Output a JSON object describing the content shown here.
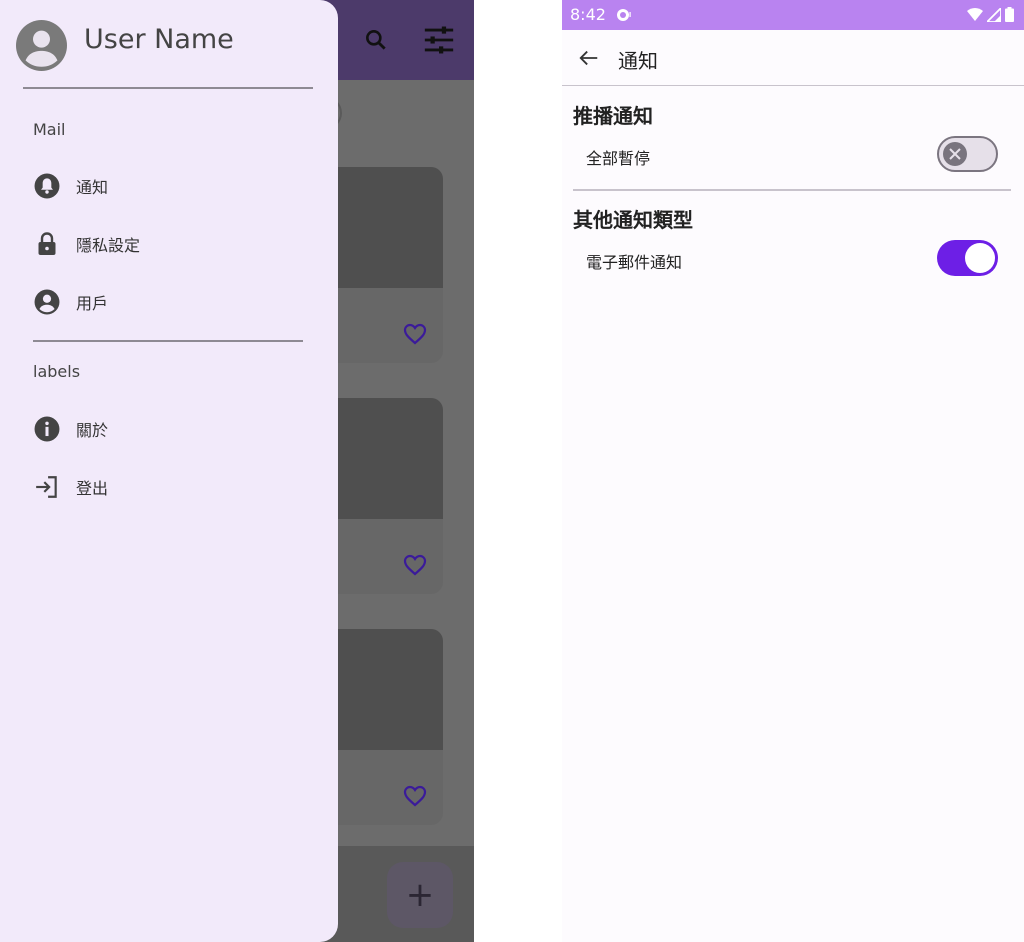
{
  "left_phone": {
    "appbar": {
      "search_icon": "search-icon",
      "filter_icon": "tune-icon"
    },
    "fab_label": "+",
    "drawer": {
      "user_name": "User Name",
      "sections": [
        {
          "label": "Mail"
        },
        {
          "label": "labels"
        }
      ],
      "items": [
        {
          "label": "通知",
          "icon": "bell-icon"
        },
        {
          "label": "隱私設定",
          "icon": "lock-icon"
        },
        {
          "label": "用戶",
          "icon": "account-icon"
        },
        {
          "label": "關於",
          "icon": "info-icon"
        },
        {
          "label": "登出",
          "icon": "logout-icon"
        }
      ]
    },
    "card_count": 3
  },
  "right_phone": {
    "status": {
      "time": "8:42"
    },
    "topbar": {
      "title": "通知"
    },
    "sections": [
      {
        "title": "推播通知",
        "row_label": "全部暫停",
        "switch_on": false
      },
      {
        "title": "其他通知類型",
        "row_label": "電子郵件通知",
        "switch_on": true
      }
    ],
    "colors": {
      "accent": "#6d1fe6",
      "status_bar": "#b983f0",
      "drawer_bg": "#f2eafa"
    }
  }
}
